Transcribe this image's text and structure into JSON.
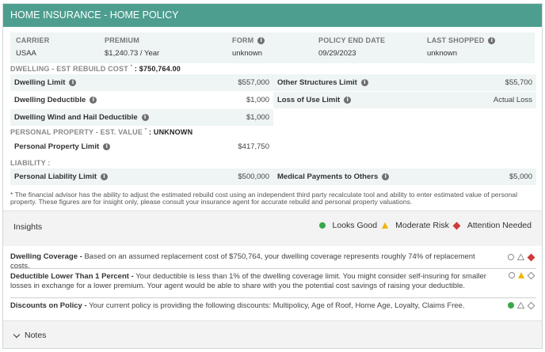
{
  "header": {
    "title": "HOME INSURANCE - HOME POLICY"
  },
  "summary": {
    "carrier": {
      "label": "CARRIER",
      "value": "USAA"
    },
    "premium": {
      "label": "PREMIUM",
      "value": "$1,240.73 / Year"
    },
    "form": {
      "label": "FORM",
      "value": "unknown"
    },
    "end_date": {
      "label": "POLICY END DATE",
      "value": "09/29/2023"
    },
    "last_shopped": {
      "label": "LAST SHOPPED",
      "value": "unknown"
    }
  },
  "dwelling": {
    "section_label": "DWELLING - EST REBUILD COST",
    "asterisk": "*",
    "section_value": ": $750,764.00",
    "limit": {
      "label": "Dwelling Limit",
      "value": "$557,000"
    },
    "deductible": {
      "label": "Dwelling Deductible",
      "value": "$1,000"
    },
    "wind_hail": {
      "label": "Dwelling Wind and Hail Deductible",
      "value": "$1,000"
    },
    "other_structures": {
      "label": "Other Structures Limit",
      "value": "$55,700"
    },
    "loss_of_use": {
      "label": "Loss of Use Limit",
      "value": "Actual Loss"
    }
  },
  "personal_property": {
    "section_label": "PERSONAL PROPERTY - EST. VALUE",
    "asterisk": "*",
    "section_value": ": UNKNOWN",
    "limit": {
      "label": "Personal Property Limit",
      "value": "$417,750"
    }
  },
  "liability": {
    "section_label": "LIABILITY :",
    "personal": {
      "label": "Personal Liability Limit",
      "value": "$500,000"
    },
    "medical": {
      "label": "Medical Payments to Others",
      "value": "$5,000"
    }
  },
  "footnote": "* The financial advisor has the ability to adjust the estimated rebuild cost using an independent third party recalculate tool and ability to enter estimated value of personal property. These figures are for insight only, please consult your insurance agent for accurate rebuild and personal property valuations.",
  "insights": {
    "title": "Insights",
    "legend": {
      "good": "Looks Good",
      "moderate": "Moderate Risk",
      "attention": "Attention Needed"
    },
    "colors": {
      "good": "#3aa64a",
      "moderate": "#f0b400",
      "attention": "#cf3b3b"
    },
    "items": [
      {
        "title": "Dwelling Coverage -",
        "text": " Based on an assumed replacement cost of $750,764, your dwelling coverage represents roughly 74% of replacement costs.",
        "status": "attention"
      },
      {
        "title": "Deductible Lower Than 1 Percent -",
        "text": " Your deductible is less than 1% of the dwelling coverage limit. You might consider self-insuring for smaller losses in exchange for a lower premium. Your agent would be able to share with you the potential cost savings of raising your deductible.",
        "status": "moderate"
      },
      {
        "title": "Discounts on Policy -",
        "text": " Your current policy is providing the following discounts: Multipolicy, Age of Roof, Home Age, Loyalty, Claims Free.",
        "status": "good"
      }
    ]
  },
  "notes": {
    "label": "Notes"
  }
}
